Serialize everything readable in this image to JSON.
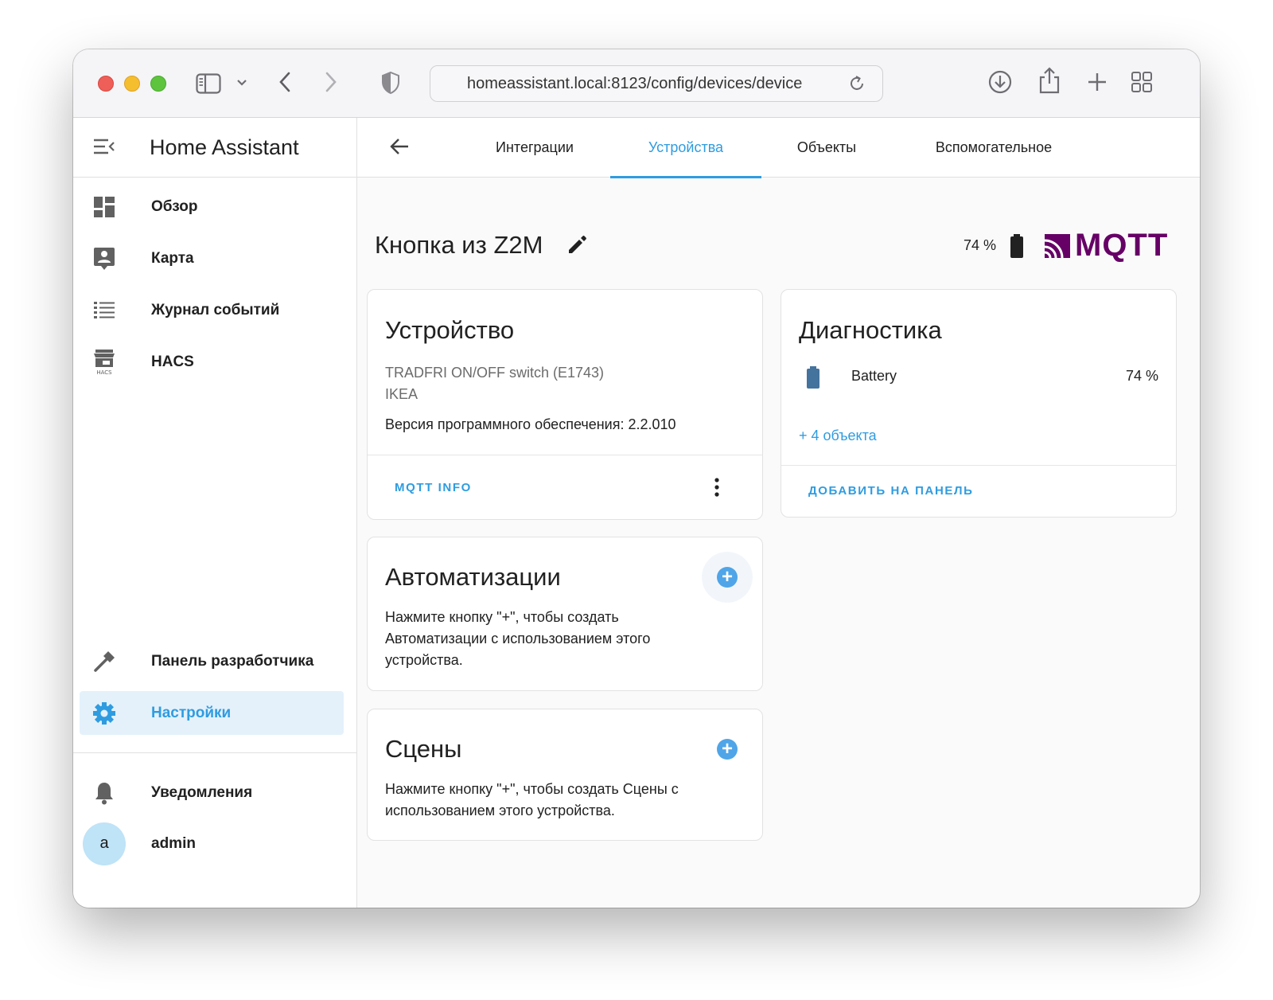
{
  "browser": {
    "url": "homeassistant.local:8123/config/devices/device"
  },
  "sidebar": {
    "title": "Home Assistant",
    "items": [
      {
        "label": "Обзор"
      },
      {
        "label": "Карта"
      },
      {
        "label": "Журнал событий"
      },
      {
        "label": "HACS"
      },
      {
        "label": "Панель разработчика"
      },
      {
        "label": "Настройки",
        "active": true
      }
    ],
    "notifications_label": "Уведомления",
    "user": {
      "avatar_letter": "a",
      "name": "admin"
    },
    "hacs_icon_caption": "HACS"
  },
  "tabs": [
    {
      "label": "Интеграции"
    },
    {
      "label": "Устройства",
      "active": true
    },
    {
      "label": "Объекты"
    },
    {
      "label": "Вспомогательное"
    }
  ],
  "device": {
    "name": "Кнопка из Z2M",
    "battery": "74 %",
    "integration_logo": "MQTT"
  },
  "device_card": {
    "title": "Устройство",
    "model": "TRADFRI ON/OFF switch (E1743)",
    "manufacturer": "IKEA",
    "firmware": "Версия программного обеспечения: 2.2.010",
    "action": "MQTT INFO"
  },
  "diagnostics_card": {
    "title": "Диагностика",
    "entity_name": "Battery",
    "entity_value": "74 %",
    "more": "+ 4 объекта",
    "action": "ДОБАВИТЬ НА ПАНЕЛЬ"
  },
  "automations_card": {
    "title": "Автоматизации",
    "text_lines": [
      "Нажмите кнопку \"+\", чтобы создать",
      "Автоматизации с использованием этого",
      "устройства."
    ]
  },
  "scenes_card": {
    "title": "Сцены",
    "text_lines": [
      "Нажмите кнопку \"+\", чтобы создать Сцены с",
      "использованием этого устройства."
    ]
  },
  "colors": {
    "accent": "#2f9ce0",
    "mqtt_purple": "#660066",
    "traffic_red": "#ed5f58",
    "traffic_yellow": "#f5be2f",
    "traffic_green": "#5ec43e"
  }
}
